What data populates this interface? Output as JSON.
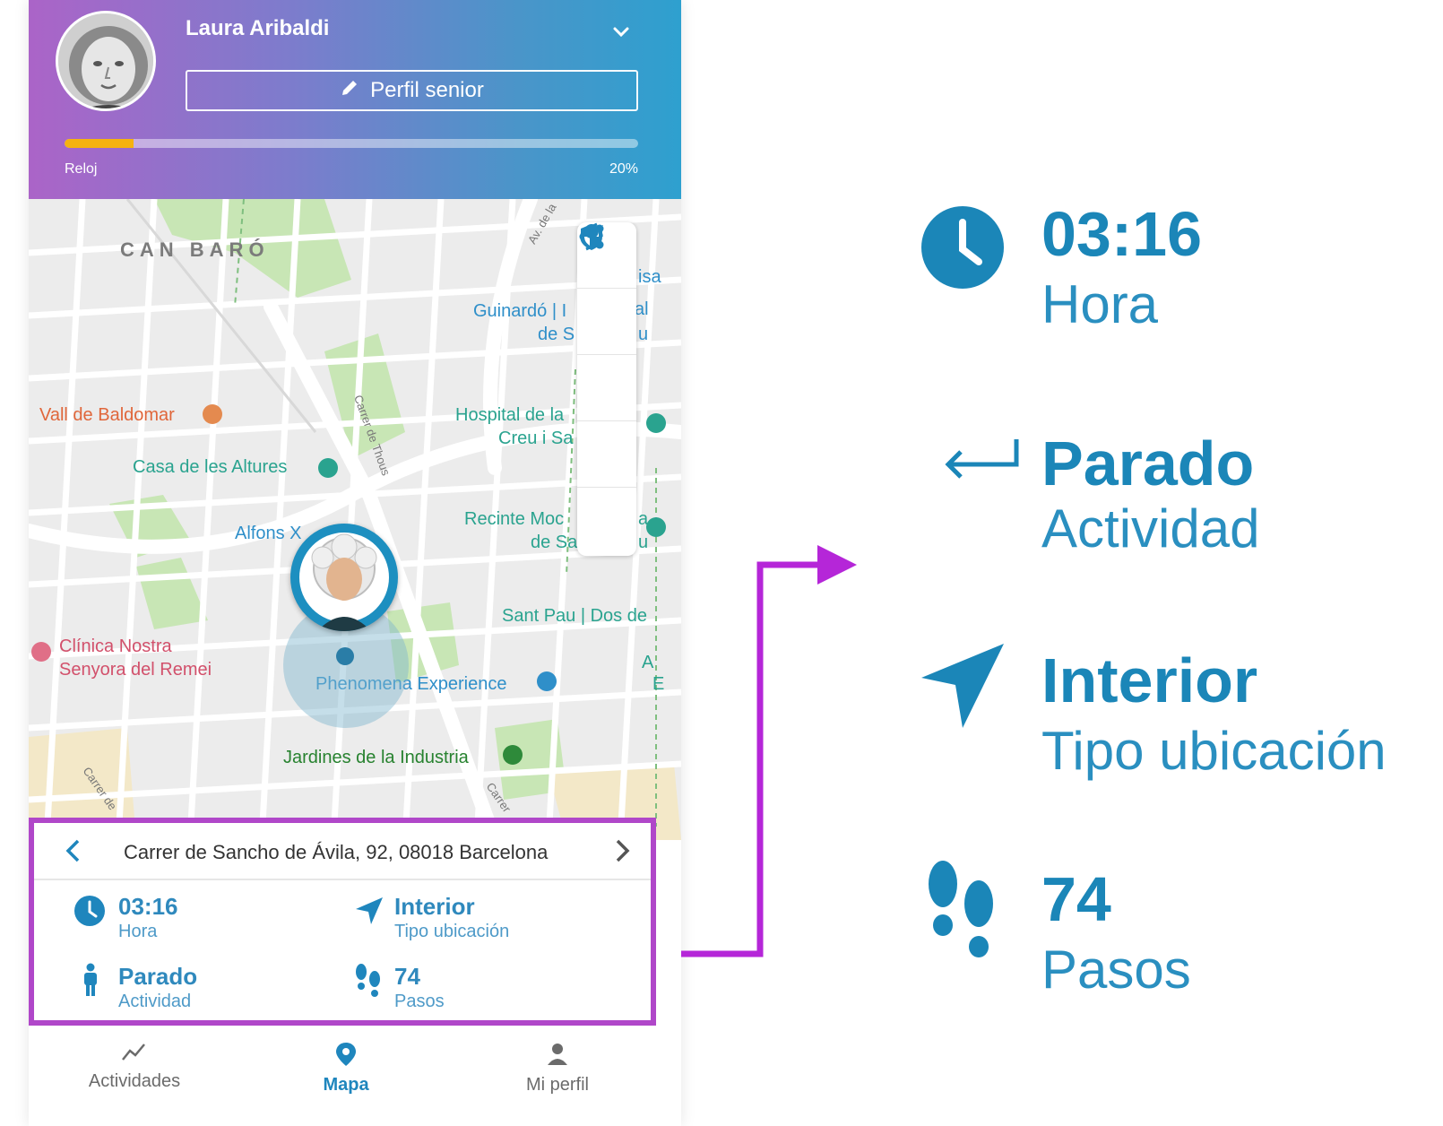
{
  "header": {
    "user_name": "Laura Aribaldi",
    "profile_button_label": "Perfil senior",
    "progress": {
      "label": "Reloj",
      "value_text": "20%",
      "fraction": 0.12
    },
    "colors": {
      "gradient_start": "#ab64c8",
      "gradient_end": "#2ea0cf",
      "progress": "#f5b20f"
    }
  },
  "map": {
    "labels": {
      "district": "CAN BARÓ",
      "street_avila": "Av. de la",
      "poi_vall": "Vall de Baldomar",
      "poi_casa": "Casa de les Altures",
      "poi_alfons": "Alfons X",
      "poi_guinardo_1": "Guinardó | I",
      "poi_guinardo_1b": "al",
      "poi_guinardo_2": "de S",
      "poi_guinardo_2b": "u",
      "poi_casa_right": "isa",
      "poi_hospital_1": "Hospital de la",
      "poi_hospital_2": "Creu i Sa",
      "poi_recinte_1": "Recinte Moc",
      "poi_recinte_1b": "a",
      "poi_recinte_2": "de Sa",
      "poi_recinte_2b": "u",
      "poi_santpau": "Sant Pau | Dos de",
      "poi_clinica_1": "Clínica Nostra",
      "poi_clinica_2": "Senyora del Remei",
      "poi_phenomena": "Phenomena Experience",
      "poi_jardines": "Jardines de la Industria",
      "poi_a_1": "A",
      "poi_a_2": "E",
      "street_thous": "Carrer de Thous",
      "street_left": "Carrer de",
      "street_bottom": "Carrer"
    },
    "tools": [
      "refresh-icon",
      "share-icon",
      "navigation-icon",
      "shield-icon",
      "pin-icon"
    ]
  },
  "card": {
    "address": "Carrer de Sancho de Ávila, 92, 08018 Barcelona",
    "stats": {
      "time": {
        "value": "03:16",
        "label": "Hora"
      },
      "location": {
        "value": "Interior",
        "label": "Tipo ubicación"
      },
      "activity": {
        "value": "Parado",
        "label": "Actividad"
      },
      "steps": {
        "value": "74",
        "label": "Pasos"
      }
    },
    "highlight_color": "#b047c9"
  },
  "bottom_nav": {
    "items": [
      {
        "label": "Actividades",
        "icon": "activity-chart-icon",
        "active": false
      },
      {
        "label": "Mapa",
        "icon": "map-pin-icon",
        "active": true
      },
      {
        "label": "Mi perfil",
        "icon": "person-icon",
        "active": false
      }
    ],
    "active_color": "#1f86bd",
    "inactive_color": "#6b6b6b"
  },
  "detail_panel": {
    "time": {
      "value": "03:16",
      "label": "Hora"
    },
    "activity": {
      "value": "Parado",
      "label": "Actividad"
    },
    "location": {
      "value": "Interior",
      "label": "Tipo ubicación"
    },
    "steps": {
      "value": "74",
      "label": "Pasos"
    },
    "color": "#1b86b8"
  }
}
